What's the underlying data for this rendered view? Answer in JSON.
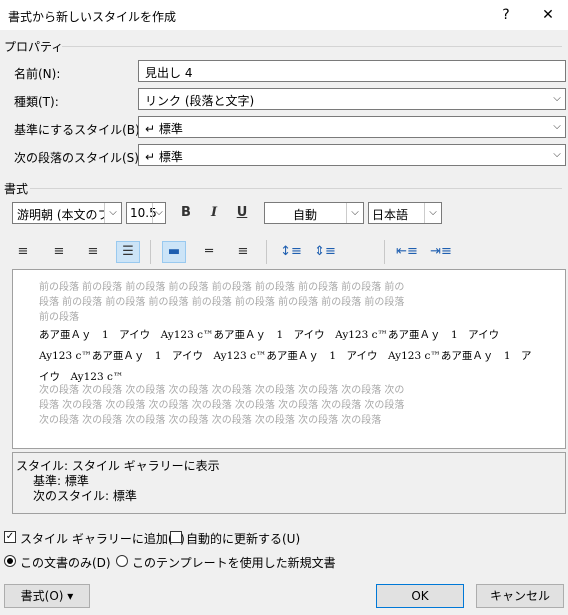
{
  "dialog": {
    "title": "書式から新しいスタイルを作成",
    "help": "?",
    "close": "✕"
  },
  "properties": {
    "section": "プロパティ",
    "name_label": "名前(N):",
    "name_value": "見出し  4",
    "type_label": "種類(T):",
    "type_value": "リンク (段落と文字)",
    "base_label": "基準にするスタイル(B):",
    "base_value": "↵ 標準",
    "next_label": "次の段落のスタイル(S):",
    "next_value": "↵ 標準"
  },
  "format": {
    "section": "書式",
    "font": "游明朝 (本文のフ",
    "size": "10.5",
    "bold": "B",
    "italic": "I",
    "underline": "U",
    "color": "自動",
    "language": "日本語"
  },
  "preview": {
    "prev_lines": [
      "前の段落 前の段落 前の段落 前の段落 前の段落 前の段落 前の段落 前の段落 前の",
      "段落 前の段落 前の段落 前の段落 前の段落 前の段落 前の段落 前の段落 前の段落",
      "前の段落"
    ],
    "sample_lines": [
      "あア亜Ａｙ　1　アイウ　Ay123 c™あア亜Ａｙ　1　アイウ　Ay123 c™あア亜Ａｙ　1　アイウ",
      "Ay123 c™あア亜Ａｙ　1　アイウ　Ay123 c™あア亜Ａｙ　1　アイウ　Ay123 c™あア亜Ａｙ　1　ア",
      "イウ　Ay123 c™"
    ],
    "next_lines": [
      "次の段落 次の段落 次の段落 次の段落 次の段落 次の段落 次の段落 次の段落 次の",
      "段落 次の段落 次の段落 次の段落 次の段落 次の段落 次の段落 次の段落 次の段落",
      "次の段落 次の段落 次の段落 次の段落 次の段落 次の段落 次の段落 次の段落"
    ]
  },
  "description": {
    "line1": "スタイル: スタイル ギャラリーに表示",
    "line2": "基準: 標準",
    "line3": "次のスタイル: 標準"
  },
  "options": {
    "add_gallery": "スタイル ギャラリーに追加(S)",
    "add_gallery_checked": true,
    "auto_update": "自動的に更新する(U)",
    "auto_update_checked": false,
    "this_doc": "この文書のみ(D)",
    "template": "このテンプレートを使用した新規文書"
  },
  "buttons": {
    "format": "書式(O) ▾",
    "ok": "OK",
    "cancel": "キャンセル"
  }
}
